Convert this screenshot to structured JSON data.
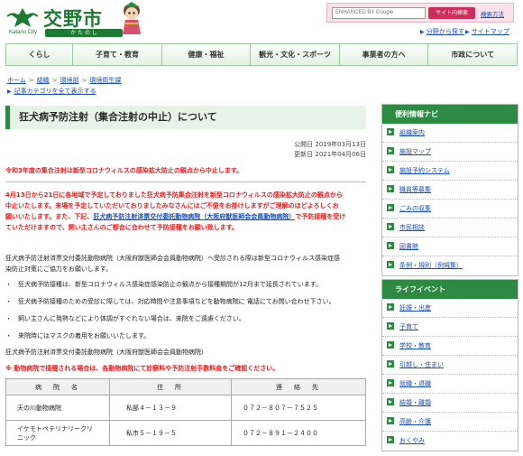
{
  "header": {
    "logo_title": "交野市",
    "logo_en": "Katano City",
    "logo_kana": "か た の し"
  },
  "search": {
    "placeholder": "ENHANCED BY Google",
    "button": "サイト内検索",
    "help": "検索方法"
  },
  "util_links": [
    "分野から探す",
    "サイトマップ"
  ],
  "nav": [
    "くらし",
    "子育て・教育",
    "健康・福祉",
    "観光・文化・スポーツ",
    "事業者の方へ",
    "市政について"
  ],
  "breadcrumb": [
    "ホーム",
    "組織",
    "環境部",
    "環境衛生課"
  ],
  "category_link": "記事カテゴリを全て表示する",
  "article": {
    "title": "狂犬病予防注射（集合注射の中止）について",
    "published": "公開日 2019年03月13日",
    "updated": "更新日 2021年04月06日",
    "notice": "令和3年度の集合注射は新型コロナウィルスの感染拡大防止の観点から中止します。",
    "red_para_1": "4月13日から21日に各地域で予定しておりました狂犬病予防集合注射を新型コロナウィルスの感染拡大防止の観点から",
    "red_para_2": "中止いたします。来場を予定していただいておりましたみなさんにはご不便をお掛けしますがご理解のほどよろしくお",
    "red_para_3a": "願いいたします。また、下記、",
    "red_para_link": "狂犬病予防注射済票交付委託動物病院（大阪府獣医師会会員動物病院）",
    "red_para_3b": "で予防接種を受け",
    "red_para_4": "ていただけますので、飼い主さんのご都合に合わせて予防接種をお願い致します。",
    "para_1": "狂犬病予防注射済票交付委託動物病院（大阪府獣医師会会員動物病院）へ受診される際は新型コロナウィルス感染症感",
    "para_2": "染防止対策にご協力をお願いします。",
    "bullets": [
      "狂犬病予防接種は、新型コロナウィルス感染症感染防止の観点から接種期間が12月まで延長されています。",
      "狂犬病予防接種のための受診に際しては、対応時間や注意事項などを動物病院に 電話にてお問い合わせ下さい。",
      "飼い主さんに発熱などにより体調がすぐれない場合は、来院をご遠慮ください。",
      "来院時にはマスクの着用をお願いいたします。"
    ],
    "hospitals_heading": "狂犬病予防注射済票交付委託動物病院（大阪府獣医師会会員動物病院）",
    "hospitals_warning": "※ 動物病院で接種される場合は、各動物病院にて診察料や予防注射手数料金をご確認ください。",
    "table_headers": [
      "病　院　名",
      "住　所",
      "連　絡　先"
    ],
    "table_rows": [
      [
        "天の川動物病院",
        "私部４－１３－９",
        "０７２－８０７－７５２５"
      ],
      [
        "イケモトペテリナリークリニック",
        "私市５－１９－５",
        "０７２－８９１－２４００"
      ]
    ]
  },
  "sidebar": {
    "nav_title": "便利情報ナビ",
    "nav_items": [
      "組織案内",
      "施設マップ",
      "施設予約システム",
      "職員等募集",
      "ごみの収集",
      "市民相談",
      "図書館",
      "条例・規則（例規集）"
    ],
    "life_title": "ライフイベント",
    "life_items": [
      "妊娠・出産",
      "子育て",
      "学校・教育",
      "引越し・住まい",
      "就職・退職",
      "結婚・離婚",
      "高齢・介護",
      "おくやみ"
    ]
  }
}
